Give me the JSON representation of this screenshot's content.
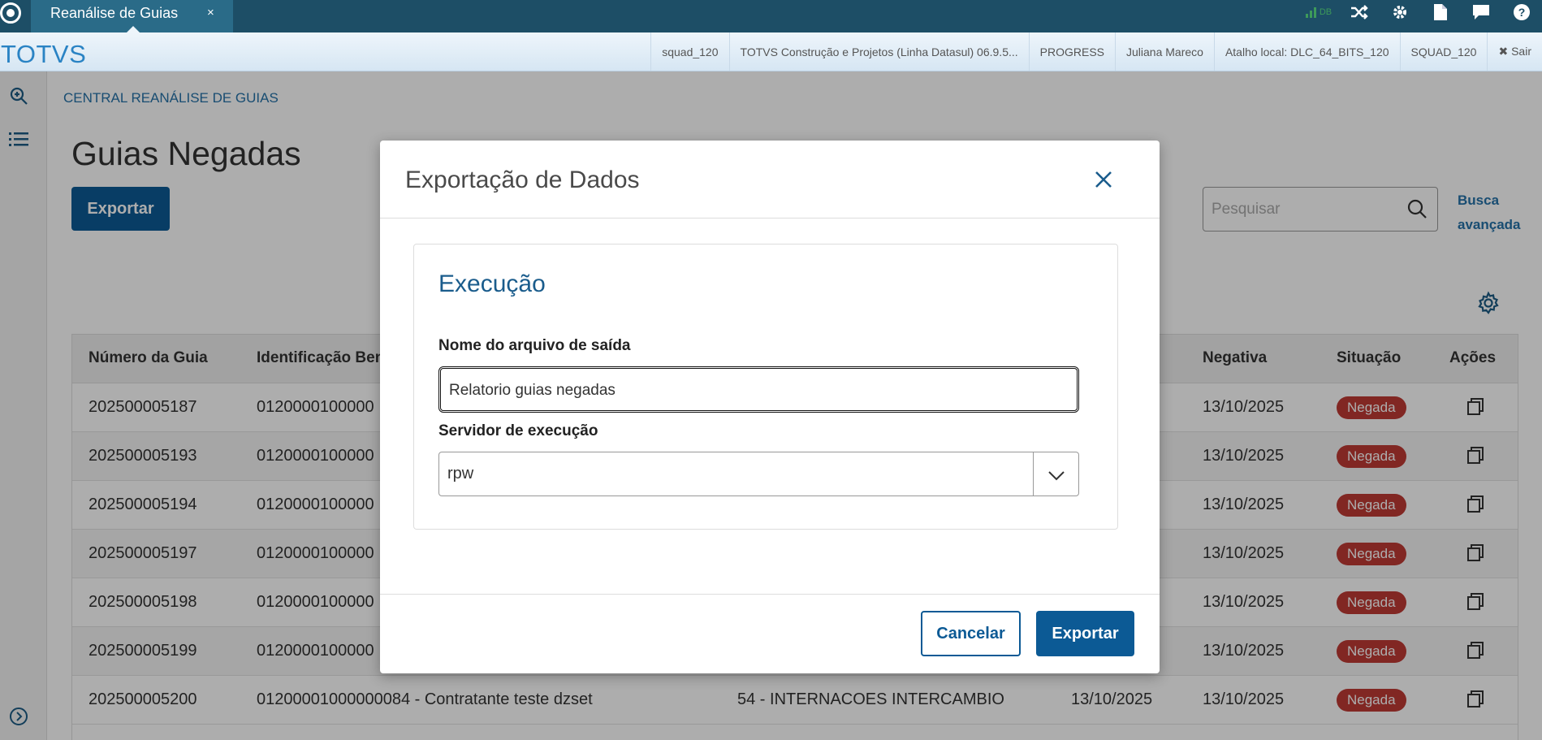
{
  "tab": {
    "label": "Reanálise de Guias",
    "close": "×"
  },
  "brand": "TOTVS",
  "info_bar": [
    "squad_120",
    "TOTVS Construção e Projetos (Linha Datasul) 06.9.5...",
    "PROGRESS",
    "Juliana Mareco",
    "Atalho local: DLC_64_BITS_120",
    "SQUAD_120",
    "✖ Sair"
  ],
  "top_icons": {
    "signal": "DB"
  },
  "breadcrumb": "CENTRAL REANÁLISE DE GUIAS",
  "page_title": "Guias Negadas",
  "export_label": "Exportar",
  "search_placeholder": "Pesquisar",
  "advanced_search": {
    "line1": "Busca",
    "line2": "avançada"
  },
  "table": {
    "headers": [
      "Número da Guia",
      "Identificação Ben",
      "Negativa",
      "Situação",
      "Ações"
    ],
    "rows": [
      {
        "numero": "202500005187",
        "ident": "0120000100000",
        "tipo": "",
        "data": "",
        "negativa": "13/10/2025",
        "situacao": "Negada"
      },
      {
        "numero": "202500005193",
        "ident": "0120000100000",
        "tipo": "",
        "data": "",
        "negativa": "13/10/2025",
        "situacao": "Negada"
      },
      {
        "numero": "202500005194",
        "ident": "0120000100000",
        "tipo": "",
        "data": "",
        "negativa": "13/10/2025",
        "situacao": "Negada"
      },
      {
        "numero": "202500005197",
        "ident": "0120000100000",
        "tipo": "",
        "data": "",
        "negativa": "13/10/2025",
        "situacao": "Negada"
      },
      {
        "numero": "202500005198",
        "ident": "0120000100000",
        "tipo": "",
        "data": "",
        "negativa": "13/10/2025",
        "situacao": "Negada"
      },
      {
        "numero": "202500005199",
        "ident": "0120000100000",
        "tipo": "",
        "data": "",
        "negativa": "13/10/2025",
        "situacao": "Negada"
      },
      {
        "numero": "202500005200",
        "ident": "01200001000000084 - Contratante teste dzset",
        "tipo": "54 - INTERNACOES INTERCAMBIO",
        "data": "13/10/2025",
        "negativa": "13/10/2025",
        "situacao": "Negada"
      }
    ]
  },
  "modal": {
    "title": "Exportação de Dados",
    "section_title": "Execução",
    "file_label": "Nome do arquivo de saída",
    "file_value": "Relatorio guias negadas",
    "server_label": "Servidor de execução",
    "server_value": "rpw",
    "cancel_label": "Cancelar",
    "export_label": "Exportar"
  },
  "colors": {
    "accent": "#0c5a95",
    "header": "#1d4e66",
    "badge": "#be3a34"
  }
}
